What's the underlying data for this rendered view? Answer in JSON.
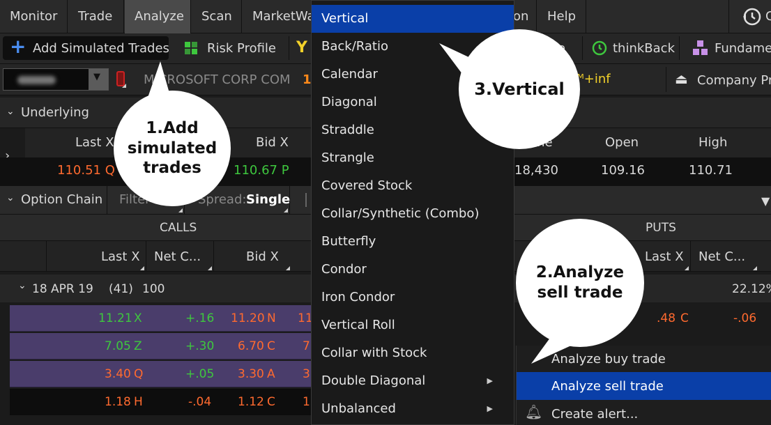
{
  "menubar": {
    "items": [
      "Monitor",
      "Trade",
      "Analyze",
      "Scan",
      "MarketWa",
      "on",
      "Help"
    ],
    "active": "Analyze",
    "clock_partial": "C"
  },
  "toolbar": {
    "add_simulated_trades": "Add Simulated Trades",
    "risk_profile": "Risk Profile",
    "partial": "e",
    "thinkback": "thinkBack",
    "fundame": "Fundame"
  },
  "symbolbar": {
    "symbol_name": "MICROSOFT CORP COM",
    "leading_digit": "1",
    "inf_label": "+inf",
    "company_profile": "Company Pro"
  },
  "underlying": {
    "header": "Underlying",
    "columns": {
      "last_x": "Last X",
      "bid_x": "Bid X",
      "volume_partial": "me",
      "open": "Open",
      "high": "High"
    },
    "values": {
      "last": "110.51",
      "last_ex": "Q",
      "bid": "110.67",
      "bid_ex": "P",
      "volume": "18,430",
      "open": "109.16",
      "high": "110.71"
    }
  },
  "option_chain": {
    "header": "Option Chain",
    "filter_label": "Filter",
    "spread_label": "Spread:",
    "spread_value": "Single",
    "calls_label": "CALLS",
    "puts_label": "PUTS",
    "call_columns": [
      "Last X",
      "Net C...",
      "Bid X"
    ],
    "put_columns": [
      "Last X",
      "Net C..."
    ],
    "expiry": {
      "date": "18 APR 19",
      "days": "(41)",
      "mult": "100",
      "iv": "22.12%"
    },
    "rows": [
      {
        "last": "11.21",
        "last_ex": "X",
        "net": "+.16",
        "bid": "11.20",
        "bid_ex": "N",
        "partial": "11"
      },
      {
        "last": "7.05",
        "last_ex": "Z",
        "net": "+.30",
        "bid": "6.70",
        "bid_ex": "C",
        "partial": "7"
      },
      {
        "last": "3.40",
        "last_ex": "Q",
        "net": "+.05",
        "bid": "3.30",
        "bid_ex": "A",
        "partial": "3"
      },
      {
        "last": "1.18",
        "last_ex": "H",
        "net": "-.04",
        "bid": "1.12",
        "bid_ex": "C",
        "partial": "1"
      }
    ],
    "put_row": {
      "last": ".48",
      "last_ex": "C",
      "net": "-.06"
    }
  },
  "spread_menu": {
    "items": [
      "Vertical",
      "Back/Ratio",
      "Calendar",
      "Diagonal",
      "Straddle",
      "Strangle",
      "Covered Stock",
      "Collar/Synthetic (Combo)",
      "Butterfly",
      "Condor",
      "Iron Condor",
      "Vertical Roll",
      "Collar with Stock",
      "Double Diagonal",
      "Unbalanced"
    ],
    "selected": "Vertical"
  },
  "context_menu": {
    "buy": "Analyze buy trade",
    "sell": "Analyze sell trade",
    "alert": "Create alert..."
  },
  "callouts": {
    "step1": "1.Add simulated trades",
    "step2": "2.Analyze sell trade",
    "step3": "3.Vertical"
  },
  "colors": {
    "accent_blue": "#0a3fa8",
    "green": "#3ec73e",
    "orange": "#ff6a2f",
    "row_purple": "#4a3d6b"
  }
}
